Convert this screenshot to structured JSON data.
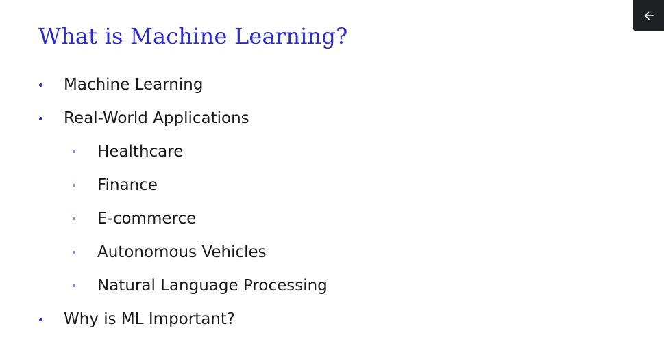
{
  "slide": {
    "title": "What is Machine Learning?",
    "bullets": [
      {
        "level": 1,
        "text": "Machine Learning"
      },
      {
        "level": 1,
        "text": "Real-World Applications"
      },
      {
        "level": 2,
        "text": "Healthcare"
      },
      {
        "level": 2,
        "text": "Finance"
      },
      {
        "level": 2,
        "text": "E-commerce"
      },
      {
        "level": 2,
        "text": "Autonomous Vehicles"
      },
      {
        "level": 2,
        "text": "Natural Language Processing"
      },
      {
        "level": 1,
        "text": "Why is ML Important?"
      }
    ]
  },
  "back_button": {
    "icon": "arrow-left-icon"
  },
  "colors": {
    "title": "#2b2bcc",
    "bullet_level1": "#2b2bcc",
    "bullet_level2": "#8a7fc8",
    "button_bg": "#1f2023"
  }
}
